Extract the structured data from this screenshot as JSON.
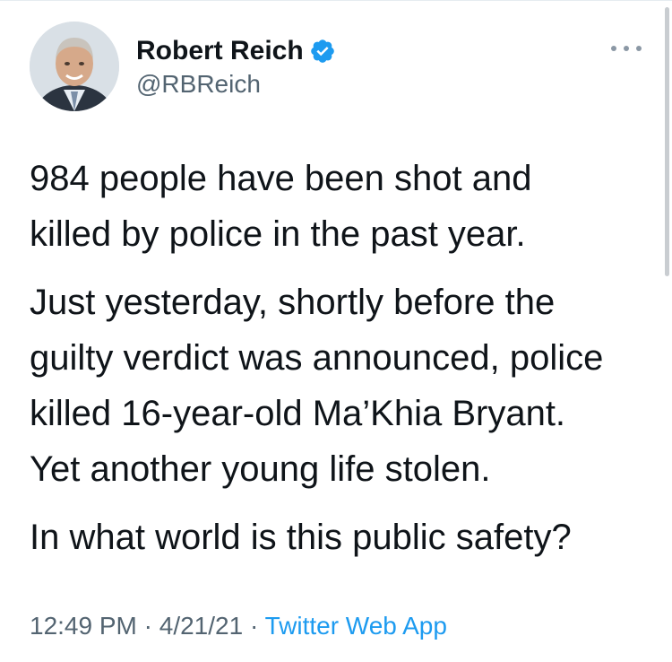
{
  "author": {
    "display_name": "Robert Reich",
    "handle": "@RBReich",
    "verified": true,
    "avatar_icon": "profile-photo",
    "verified_icon": "verified-badge-icon"
  },
  "more_icon": "more-options-icon",
  "tweet": {
    "paragraphs": [
      {
        "lines": [
          "984 people have been shot and",
          "killed by police in the past year."
        ]
      },
      {
        "lines": [
          "Just yesterday, shortly before the",
          "guilty verdict was announced, police",
          "killed 16-year-old Ma’Khia Bryant.",
          "Yet another young life stolen."
        ]
      },
      {
        "lines": [
          "In what world is this public safety?"
        ]
      }
    ]
  },
  "meta": {
    "time": "12:49 PM",
    "separator1": " · ",
    "date": "4/21/21",
    "separator2": " · ",
    "source": "Twitter Web App"
  },
  "colors": {
    "text": "#0f1419",
    "secondary": "#536471",
    "link": "#1d9bf0",
    "verified": "#1d9bf0"
  }
}
